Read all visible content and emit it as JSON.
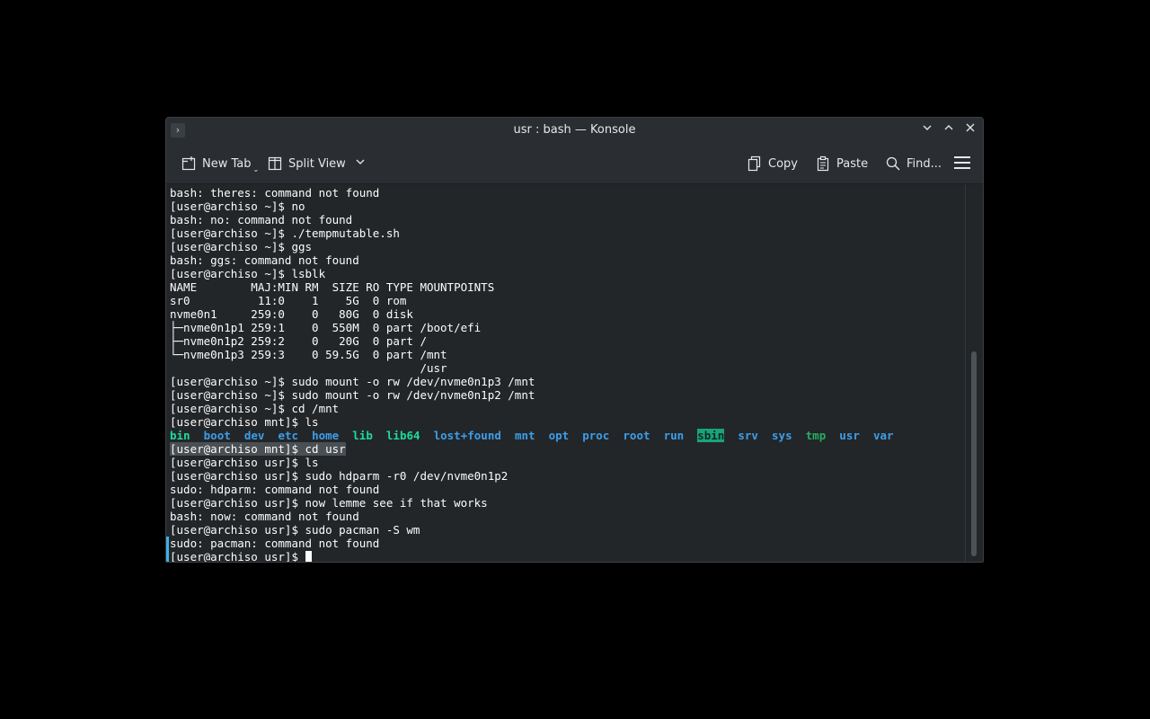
{
  "window": {
    "title": "usr : bash — Konsole"
  },
  "toolbar": {
    "new_tab": "New Tab",
    "split_view": "Split View",
    "copy": "Copy",
    "paste": "Paste",
    "find": "Find..."
  },
  "terminal": {
    "lines": [
      "bash: theres: command not found",
      "[user@archiso ~]$ no",
      "bash: no: command not found",
      "[user@archiso ~]$ ./tempmutable.sh",
      "[user@archiso ~]$ ggs",
      "bash: ggs: command not found",
      "[user@archiso ~]$ lsblk",
      "NAME        MAJ:MIN RM  SIZE RO TYPE MOUNTPOINTS",
      "sr0          11:0    1    5G  0 rom",
      "nvme0n1     259:0    0   80G  0 disk",
      "├─nvme0n1p1 259:1    0  550M  0 part /boot/efi",
      "├─nvme0n1p2 259:2    0   20G  0 part /",
      "└─nvme0n1p3 259:3    0 59.5G  0 part /mnt",
      "                                     /usr",
      "[user@archiso ~]$ sudo mount -o rw /dev/nvme0n1p3 /mnt",
      "[user@archiso ~]$ sudo mount -o rw /dev/nvme0n1p2 /mnt",
      "[user@archiso ~]$ cd /mnt",
      "[user@archiso mnt]$ ls"
    ],
    "ls_output": [
      {
        "name": "bin",
        "style": "ls-green"
      },
      {
        "name": "boot",
        "style": "ls-blue"
      },
      {
        "name": "dev",
        "style": "ls-blue"
      },
      {
        "name": "etc",
        "style": "ls-blue"
      },
      {
        "name": "home",
        "style": "ls-blue"
      },
      {
        "name": "lib",
        "style": "ls-green"
      },
      {
        "name": "lib64",
        "style": "ls-green"
      },
      {
        "name": "lost+found",
        "style": "ls-blue"
      },
      {
        "name": "mnt",
        "style": "ls-blue"
      },
      {
        "name": "opt",
        "style": "ls-blue"
      },
      {
        "name": "proc",
        "style": "ls-blue"
      },
      {
        "name": "root",
        "style": "ls-blue"
      },
      {
        "name": "run",
        "style": "ls-blue"
      },
      {
        "name": "sbin",
        "style": "ls-hl"
      },
      {
        "name": "srv",
        "style": "ls-blue"
      },
      {
        "name": "sys",
        "style": "ls-blue"
      },
      {
        "name": "tmp",
        "style": "ls-green2"
      },
      {
        "name": "usr",
        "style": "ls-blue"
      },
      {
        "name": "var",
        "style": "ls-blue"
      }
    ],
    "selected_line": "[user@archiso mnt]$ cd usr",
    "lines_after": [
      "[user@archiso usr]$ ls",
      "[user@archiso usr]$ sudo hdparm -r0 /dev/nvme0n1p2",
      "sudo: hdparm: command not found",
      "[user@archiso usr]$ now lemme see if that works",
      "bash: now: command not found",
      "[user@archiso usr]$ sudo pacman -S wm",
      "sudo: pacman: command not found"
    ],
    "prompt": "[user@archiso usr]$ "
  },
  "colors": {
    "accent": "#3daee9",
    "dir_blue": "#3d9ee9",
    "exec_green": "#1cdc9a"
  }
}
